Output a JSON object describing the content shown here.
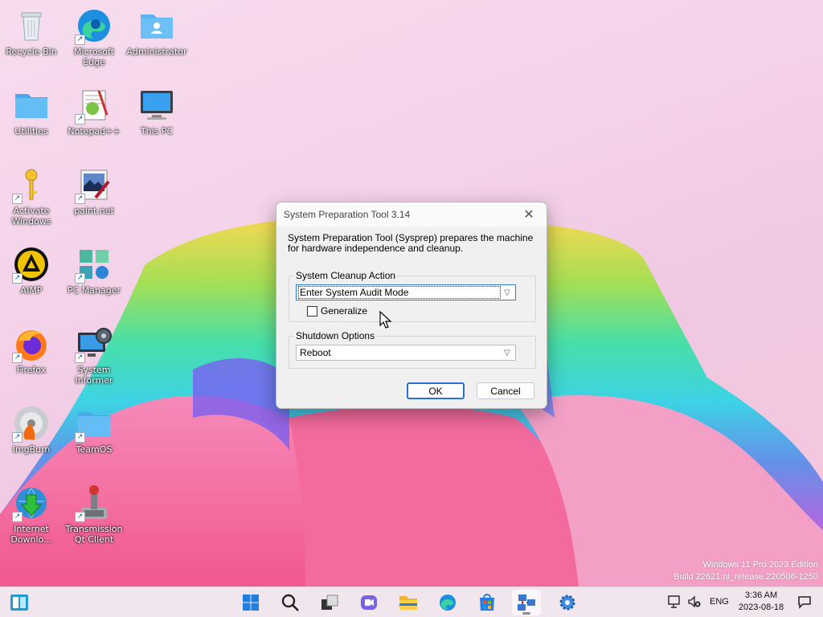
{
  "desktop": {
    "icons": [
      {
        "label": "Recycle Bin"
      },
      {
        "label": "Microsoft Edge"
      },
      {
        "label": "Administrator"
      },
      {
        "label": "Utilities"
      },
      {
        "label": "Notepad++"
      },
      {
        "label": "This PC"
      },
      {
        "label": "Activate Windows"
      },
      {
        "label": "paint.net"
      },
      {
        "label": "AIMP"
      },
      {
        "label": "PC Manager"
      },
      {
        "label": "Firefox"
      },
      {
        "label": "System Informer"
      },
      {
        "label": "ImgBurn"
      },
      {
        "label": "TeamOS"
      },
      {
        "label": "Internet Downlo..."
      },
      {
        "label": "Transmission Qt Client"
      }
    ]
  },
  "dialog": {
    "title": "System Preparation Tool 3.14",
    "description": "System Preparation Tool (Sysprep) prepares the machine for hardware independence and cleanup.",
    "cleanup_group_label": "System Cleanup Action",
    "cleanup_value": "Enter System Audit Mode",
    "generalize_label": "Generalize",
    "generalize_checked": false,
    "shutdown_group_label": "Shutdown Options",
    "shutdown_value": "Reboot",
    "ok_label": "OK",
    "cancel_label": "Cancel"
  },
  "watermark": {
    "line1": "Windows 11 Pro 2023 Edition",
    "line2": "Build 22621.ni_release.220506-1250"
  },
  "taskbar": {
    "icons": [
      "widgets-icon",
      "start-icon",
      "search-icon",
      "task-view-icon",
      "chat-icon",
      "file-explorer-icon",
      "edge-icon",
      "store-icon",
      "sysprep-icon",
      "settings-icon"
    ],
    "language": "ENG",
    "time": "3:36 AM",
    "date": "2023-08-18"
  },
  "colors": {
    "accent": "#2a6fd1",
    "taskbar_bg": "#f1e6ee"
  }
}
